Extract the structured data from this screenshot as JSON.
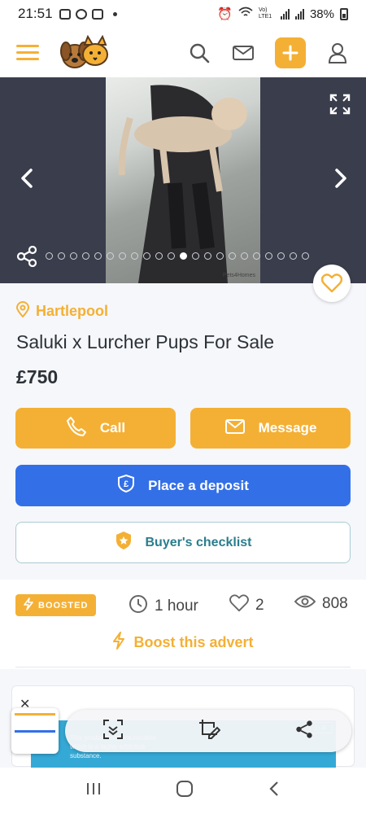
{
  "status_bar": {
    "time": "21:51",
    "battery": "38%",
    "network_label": "Vo) LTE1"
  },
  "header": {
    "logo_icon": "pets-logo-icon",
    "icons": [
      "menu-icon",
      "search-icon",
      "mail-icon",
      "plus-icon",
      "user-icon"
    ]
  },
  "gallery": {
    "photo_count": 22,
    "active_index": 11,
    "watermark": "Pets4Homes"
  },
  "listing": {
    "location": "Hartlepool",
    "title": "Saluki x Lurcher Pups For Sale",
    "price": "£750"
  },
  "actions": {
    "call_label": "Call",
    "message_label": "Message",
    "deposit_label": "Place a deposit",
    "checklist_label": "Buyer's checklist"
  },
  "stats": {
    "boosted_label": "BOOSTED",
    "time_ago": "1 hour",
    "likes": "2",
    "views": "808",
    "boost_link": "Boost this advert"
  },
  "ad": {
    "text": "This product contains nicotine which is a highly addictive substance."
  },
  "colors": {
    "accent": "#f4b035",
    "deposit": "#3370e8",
    "checklist": "#2a7d8e"
  }
}
